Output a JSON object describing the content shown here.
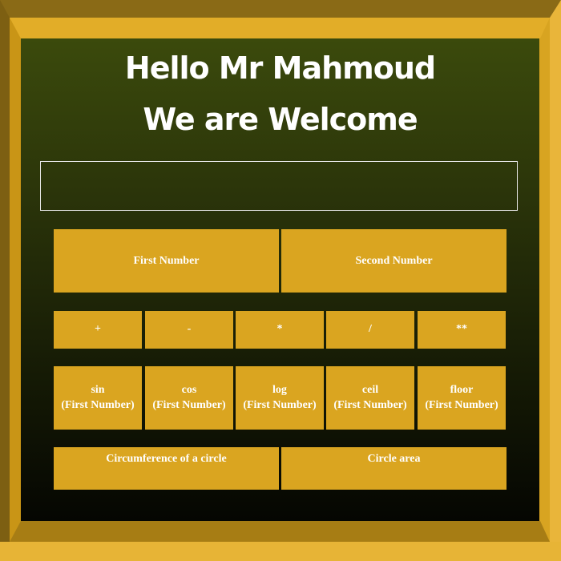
{
  "header": {
    "line1": "Hello Mr Mahmoud",
    "line2": "We are Welcome"
  },
  "display": {
    "value": "",
    "placeholder": ""
  },
  "inputs": {
    "first_placeholder": "First Number",
    "second_placeholder": "Second Number"
  },
  "operators": [
    "+",
    "-",
    "*",
    "/",
    "**"
  ],
  "functions": [
    {
      "name": "sin",
      "arg": "(First Number)"
    },
    {
      "name": "cos",
      "arg": "(First Number)"
    },
    {
      "name": "log",
      "arg": "(First Number)"
    },
    {
      "name": "ceil",
      "arg": "(First Number)"
    },
    {
      "name": "floor",
      "arg": "(First Number)"
    }
  ],
  "circle": {
    "circumference_label": "Circumference of a circle",
    "area_label": "Circle area"
  },
  "colors": {
    "frame": "#daa520",
    "button": "#daa520",
    "panel_top": "#3b4a0c",
    "panel_bottom": "#050602",
    "text": "#ffffff"
  }
}
